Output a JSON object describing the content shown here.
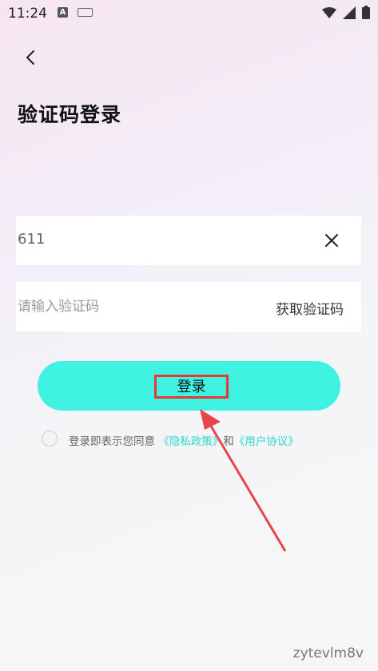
{
  "status_bar": {
    "time": "11:24",
    "a_badge": "A",
    "icons": [
      "a-badge-icon",
      "keyboard-icon",
      "wifi-icon",
      "signal-icon",
      "battery-icon"
    ]
  },
  "header": {
    "back_icon": "chevron-left-icon",
    "title": "验证码登录"
  },
  "form": {
    "phone_value": "611",
    "clear_icon": "close-icon",
    "code_placeholder": "请输入验证码",
    "get_code_label": "获取验证码",
    "login_label": "登录"
  },
  "agreement": {
    "prefix": "登录即表示您同意",
    "privacy_link": "《隐私政策》",
    "conjunction": "和",
    "terms_link": "《用户协议》"
  },
  "annotation": {
    "highlight_color": "#e53935"
  },
  "colors": {
    "accent": "#3ff2e1",
    "link": "#2ad9cb"
  },
  "watermark": "zytevlm8v"
}
